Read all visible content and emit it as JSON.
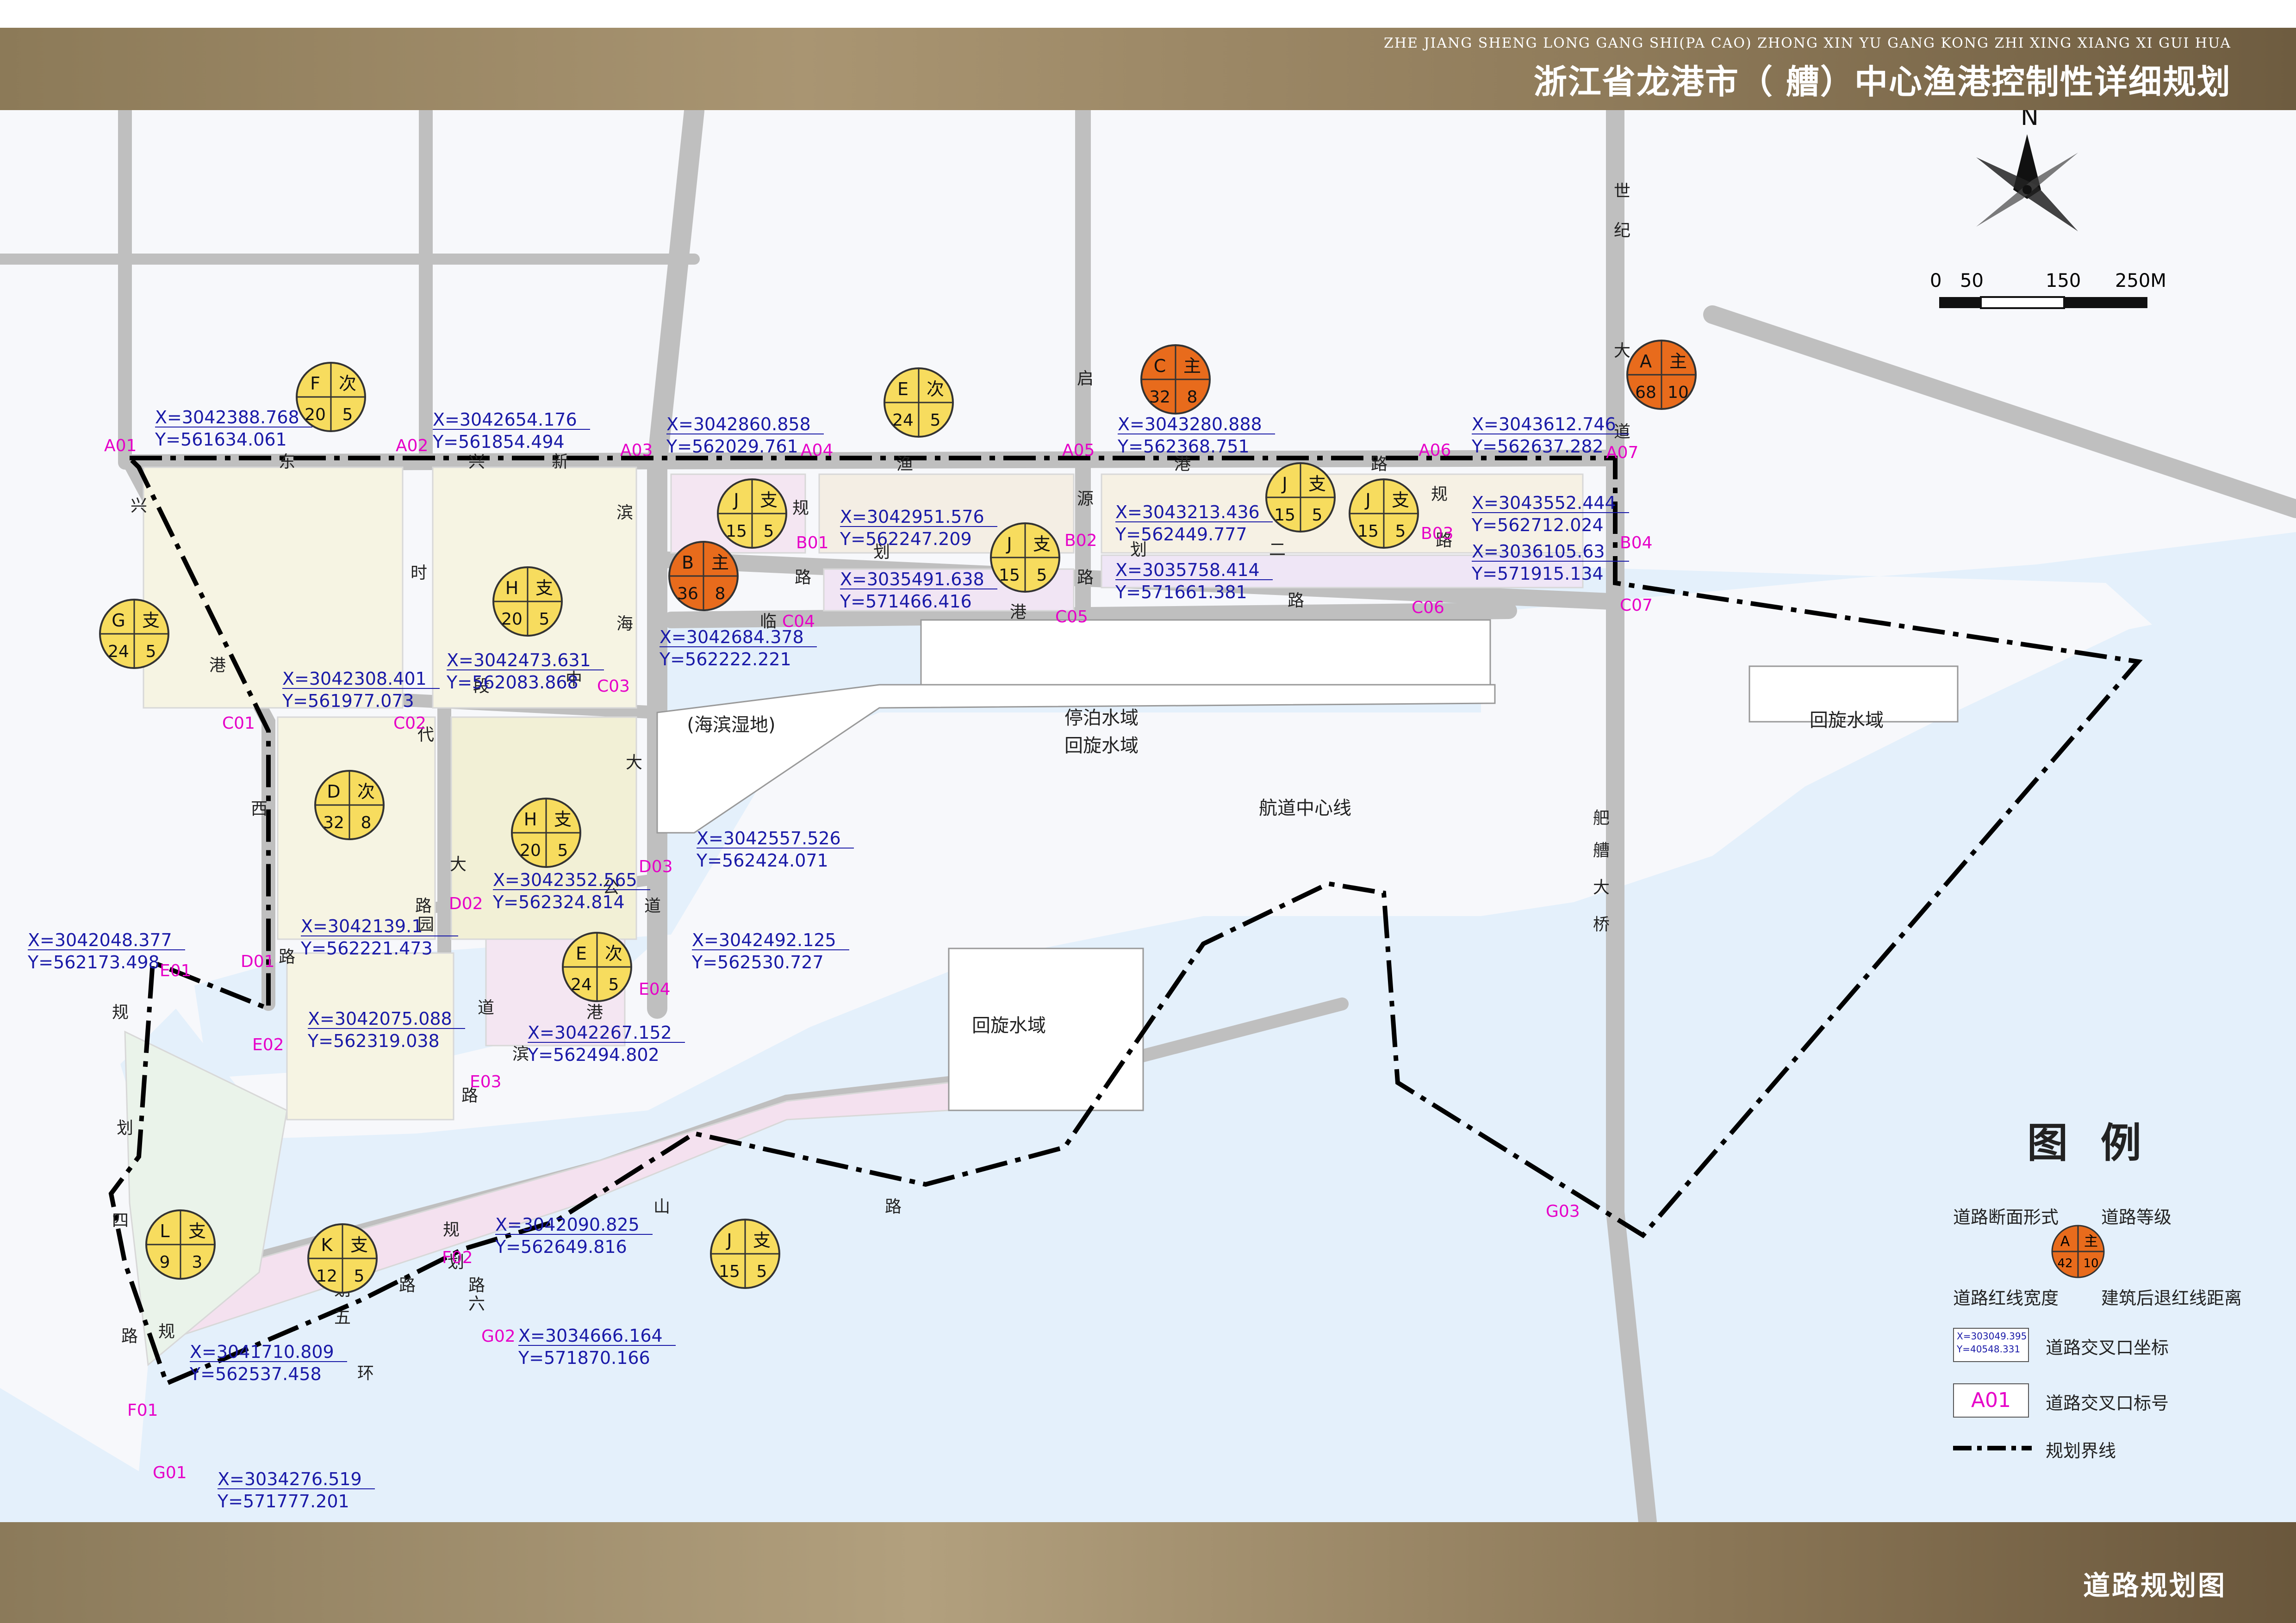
{
  "header": {
    "subtitle": "ZHE JIANG SHENG LONG GANG SHI(PA CAO) ZHONG XIN YU GANG KONG ZHI XING XIANG XI GUI HUA",
    "title": "浙江省龙港市（ 艚）中心渔港控制性详细规划"
  },
  "footer": {
    "title": "道路规划图"
  },
  "compass": {
    "label": "N"
  },
  "scale_bar": {
    "labels": [
      "0",
      "50",
      "150",
      "250M"
    ]
  },
  "colors": {
    "major_road_fill": "#e86b1c",
    "minor_road_fill": "#f7dc5e",
    "water": "#e4f0fb",
    "road": "#bfbfbf",
    "boundary": "#000000",
    "intersection_code": "#e600c8",
    "coordinate_text": "#1a1aa8"
  },
  "road_badges": [
    {
      "letter": "F",
      "grade": "次",
      "width": "20",
      "setback": "5",
      "kind": "minor"
    },
    {
      "letter": "E",
      "grade": "次",
      "width": "24",
      "setback": "5",
      "kind": "minor"
    },
    {
      "letter": "C",
      "grade": "主",
      "width": "32",
      "setback": "8",
      "kind": "major"
    },
    {
      "letter": "A",
      "grade": "主",
      "width": "68",
      "setback": "10",
      "kind": "major"
    },
    {
      "letter": "G",
      "grade": "支",
      "width": "24",
      "setback": "5",
      "kind": "minor"
    },
    {
      "letter": "H",
      "grade": "支",
      "width": "20",
      "setback": "5",
      "kind": "minor"
    },
    {
      "letter": "J",
      "grade": "支",
      "width": "15",
      "setback": "5",
      "kind": "minor"
    },
    {
      "letter": "B",
      "grade": "主",
      "width": "36",
      "setback": "8",
      "kind": "major"
    },
    {
      "letter": "J",
      "grade": "支",
      "width": "15",
      "setback": "5",
      "kind": "minor"
    },
    {
      "letter": "J",
      "grade": "支",
      "width": "15",
      "setback": "5",
      "kind": "minor"
    },
    {
      "letter": "J",
      "grade": "支",
      "width": "15",
      "setback": "5",
      "kind": "minor"
    },
    {
      "letter": "D",
      "grade": "次",
      "width": "32",
      "setback": "8",
      "kind": "minor"
    },
    {
      "letter": "H",
      "grade": "支",
      "width": "20",
      "setback": "5",
      "kind": "minor"
    },
    {
      "letter": "E",
      "grade": "次",
      "width": "24",
      "setback": "5",
      "kind": "minor"
    },
    {
      "letter": "L",
      "grade": "支",
      "width": "9",
      "setback": "3",
      "kind": "minor"
    },
    {
      "letter": "K",
      "grade": "支",
      "width": "12",
      "setback": "5",
      "kind": "minor"
    },
    {
      "letter": "J",
      "grade": "支",
      "width": "15",
      "setback": "5",
      "kind": "minor"
    }
  ],
  "intersection_codes": [
    "A01",
    "A02",
    "A03",
    "A04",
    "A05",
    "A06",
    "A07",
    "B01",
    "B02",
    "B03",
    "B04",
    "C01",
    "C02",
    "C03",
    "C04",
    "C05",
    "C06",
    "C07",
    "D01",
    "D02",
    "D03",
    "E01",
    "E02",
    "E03",
    "E04",
    "F01",
    "F02",
    "G01",
    "G02",
    "G03"
  ],
  "coordinates": [
    {
      "x": "X=3042388.768",
      "y": "Y=561634.061"
    },
    {
      "x": "X=3042654.176",
      "y": "Y=561854.494"
    },
    {
      "x": "X=3042860.858",
      "y": "Y=562029.761"
    },
    {
      "x": "X=3043280.888",
      "y": "Y=562368.751"
    },
    {
      "x": "X=3043612.746",
      "y": "Y=562637.282"
    },
    {
      "x": "X=3042951.576",
      "y": "Y=562247.209"
    },
    {
      "x": "X=3043213.436",
      "y": "Y=562449.777"
    },
    {
      "x": "X=3043552.444",
      "y": "Y=562712.024"
    },
    {
      "x": "X=3035491.638",
      "y": "Y=571466.416"
    },
    {
      "x": "X=3035758.414",
      "y": "Y=571661.381"
    },
    {
      "x": "X=3036105.63",
      "y": "Y=571915.134"
    },
    {
      "x": "X=3042684.378",
      "y": "Y=562222.221"
    },
    {
      "x": "X=3042473.631",
      "y": "Y=562083.868"
    },
    {
      "x": "X=3042308.401",
      "y": "Y=561977.073"
    },
    {
      "x": "X=3042557.526",
      "y": "Y=562424.071"
    },
    {
      "x": "X=3042352.565",
      "y": "Y=562324.814"
    },
    {
      "x": "X=3042139.1",
      "y": "Y=562221.473"
    },
    {
      "x": "X=3042048.377",
      "y": "Y=562173.498"
    },
    {
      "x": "X=3042492.125",
      "y": "Y=562530.727"
    },
    {
      "x": "X=3042075.088",
      "y": "Y=562319.038"
    },
    {
      "x": "X=3042267.152",
      "y": "Y=562494.802"
    },
    {
      "x": "X=3042090.825",
      "y": "Y=562649.816"
    },
    {
      "x": "X=3034666.164",
      "y": "Y=571870.166"
    },
    {
      "x": "X=3041710.809",
      "y": "Y=562537.458"
    },
    {
      "x": "X=3034276.519",
      "y": "Y=571777.201"
    }
  ],
  "road_names": [
    {
      "text": "东"
    },
    {
      "text": "兴"
    },
    {
      "text": "新"
    },
    {
      "text": "渔"
    },
    {
      "text": "港"
    },
    {
      "text": "路"
    },
    {
      "text": "规"
    },
    {
      "text": "划"
    },
    {
      "text": "路"
    },
    {
      "text": "规"
    },
    {
      "text": "划"
    },
    {
      "text": "二"
    },
    {
      "text": "路"
    },
    {
      "text": "临"
    },
    {
      "text": "港"
    },
    {
      "text": "路"
    },
    {
      "text": "兴"
    },
    {
      "text": "港"
    },
    {
      "text": "西"
    },
    {
      "text": "路"
    },
    {
      "text": "时"
    },
    {
      "text": "代"
    },
    {
      "text": "大"
    },
    {
      "text": "道"
    },
    {
      "text": "滨"
    },
    {
      "text": "海"
    },
    {
      "text": "大"
    },
    {
      "text": "道"
    },
    {
      "text": "世"
    },
    {
      "text": "纪"
    },
    {
      "text": "大"
    },
    {
      "text": "道"
    },
    {
      "text": "启"
    },
    {
      "text": "源"
    },
    {
      "text": "路"
    },
    {
      "text": "中"
    },
    {
      "text": "段"
    },
    {
      "text": "公"
    },
    {
      "text": "园"
    },
    {
      "text": "路"
    },
    {
      "text": "滨"
    },
    {
      "text": "港"
    },
    {
      "text": "路"
    },
    {
      "text": "规"
    },
    {
      "text": "划"
    },
    {
      "text": "四"
    },
    {
      "text": "路"
    },
    {
      "text": "规"
    },
    {
      "text": "划"
    },
    {
      "text": "六"
    },
    {
      "text": "路"
    },
    {
      "text": "规"
    },
    {
      "text": "划"
    },
    {
      "text": "五"
    },
    {
      "text": "路"
    },
    {
      "text": "环"
    },
    {
      "text": "山"
    },
    {
      "text": "路"
    },
    {
      "text": "舥"
    },
    {
      "text": "艚"
    },
    {
      "text": "大"
    },
    {
      "text": "桥"
    }
  ],
  "water_labels": [
    "停泊水域",
    "回旋水域",
    "回旋水域",
    "回旋水域",
    "航道中心线",
    "(海滨湿地)"
  ],
  "legend": {
    "title": "图 例",
    "section_form": "道路断面形式",
    "road_grade": "道路等级",
    "red_line_width": "道路红线宽度",
    "setback": "建筑后退红线距离",
    "sample_badge": {
      "letter": "A",
      "grade": "主",
      "width": "42",
      "setback": "10"
    },
    "sample_coord_x": "X=303049.395",
    "sample_coord_y": "Y=40548.331",
    "coord_label": "道路交叉口坐标",
    "code_sample": "A01",
    "code_label": "道路交叉口标号",
    "boundary_label": "规划界线"
  }
}
